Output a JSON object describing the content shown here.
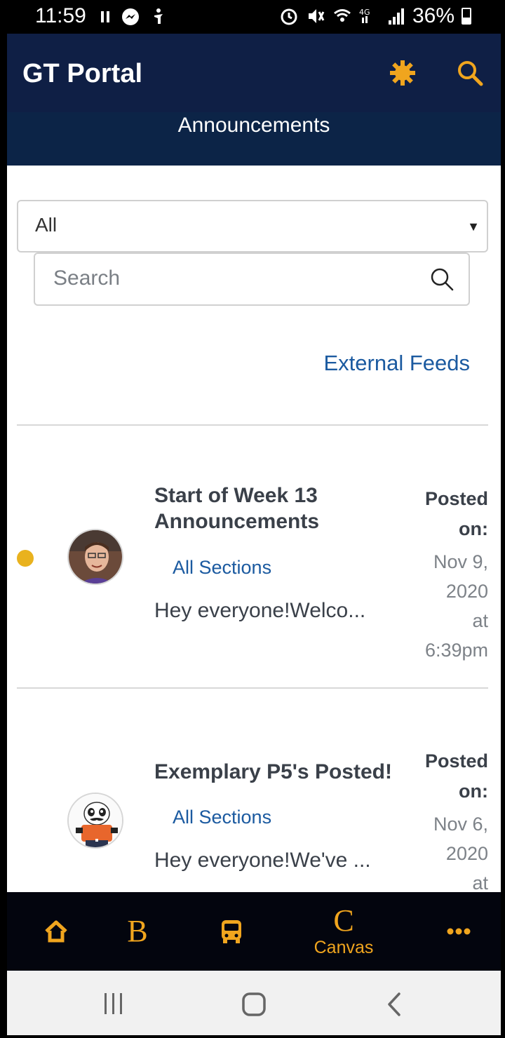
{
  "status_bar": {
    "time": "11:59",
    "battery": "36%",
    "icons": [
      "pause-icon",
      "messenger-icon",
      "accessibility-icon",
      "alarm-icon",
      "mute-icon",
      "wifi-icon",
      "lte-icon",
      "signal-icon",
      "battery-icon"
    ]
  },
  "header": {
    "app_title": "GT Portal",
    "page_title": "Announcements",
    "icons": [
      "settings-icon",
      "search-icon"
    ]
  },
  "filter": {
    "selected": "All"
  },
  "search": {
    "placeholder": "Search"
  },
  "links": {
    "external_feeds": "External Feeds"
  },
  "announcements": [
    {
      "title": "Start of Week 13 Announcements",
      "title_line1": "Start of Week 13",
      "title_line2": "Announcements",
      "section": "All Sections",
      "preview": "Hey everyone!Welco...",
      "posted_label_line1": "Posted",
      "posted_label_line2": "on:",
      "date_line1": "Nov 9,",
      "date_line2": "2020",
      "date_line3": "at",
      "date_line4": "6:39pm",
      "unread": true,
      "avatar": "person-avatar"
    },
    {
      "title": "Exemplary P5's Posted!",
      "section": "All Sections",
      "preview": "Hey everyone!We've ...",
      "posted_label_line1": "Posted",
      "posted_label_line2": "on:",
      "date_line1": "Nov 6,",
      "date_line2": "2020",
      "date_line3": "at",
      "unread": false,
      "avatar": "panda-avatar"
    }
  ],
  "tab_bar": {
    "items": [
      {
        "icon": "home-icon",
        "label": ""
      },
      {
        "icon": "b-icon",
        "letter": "B",
        "label": ""
      },
      {
        "icon": "bus-icon",
        "label": ""
      },
      {
        "icon": "canvas-icon",
        "letter": "C",
        "label": "Canvas"
      },
      {
        "icon": "more-icon",
        "label": ""
      }
    ]
  },
  "colors": {
    "header_bg": "#0f1f45",
    "subheader_bg": "#0c2447",
    "accent_gold": "#f0a51e",
    "link_blue": "#1b5aa0",
    "unread_dot": "#e9b21e",
    "tab_bar_bg": "#03050e"
  }
}
